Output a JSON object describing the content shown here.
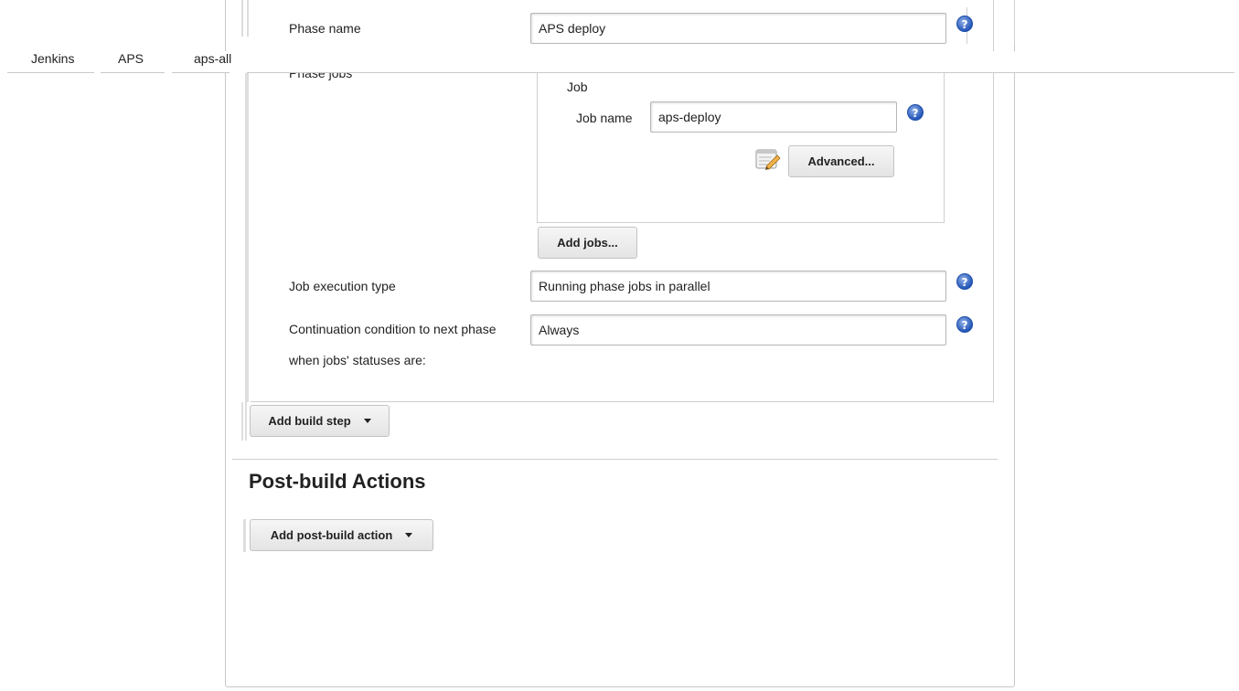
{
  "breadcrumb": {
    "items": [
      "Jenkins",
      "APS",
      "aps-all"
    ]
  },
  "phase": {
    "name_label": "Phase name",
    "name_value": "APS deploy",
    "jobs_label": "Phase jobs",
    "job_section_title": "Job",
    "job_name_label": "Job name",
    "job_name_value": "aps-deploy",
    "advanced_button": "Advanced...",
    "add_jobs_button": "Add jobs...",
    "execution_type_label": "Job execution type",
    "execution_type_value": "Running phase jobs in parallel",
    "continuation_label_line1": "Continuation condition to next phase",
    "continuation_label_line2": "when jobs' statuses are:",
    "continuation_value": "Always"
  },
  "build": {
    "add_build_step_button": "Add build step"
  },
  "post_build": {
    "title": "Post-build Actions",
    "add_action_button": "Add post-build action"
  },
  "icons": {
    "help": "help-icon",
    "notepad": "notepad-icon",
    "dropdown": "caret-down-icon"
  },
  "colors": {
    "help_icon": "#2457b8",
    "button_bg": "#e4e4e4",
    "border": "#c8c8c8"
  }
}
